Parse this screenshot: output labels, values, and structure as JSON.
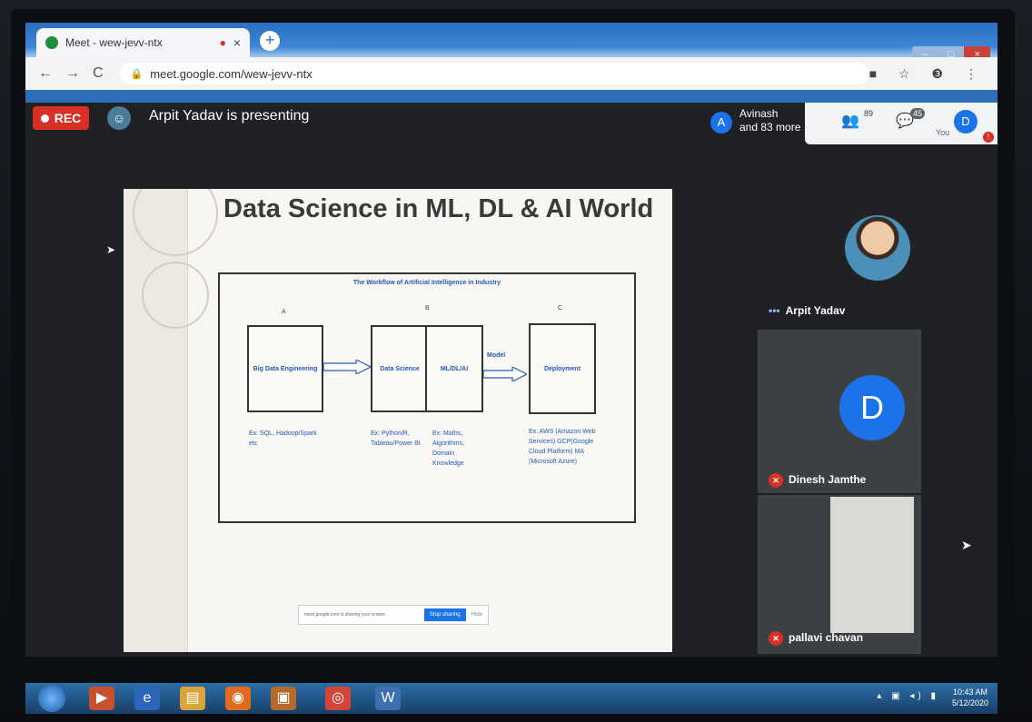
{
  "browser": {
    "tab_title": "Meet - wew-jevv-ntx",
    "tab_close": "×",
    "new_tab": "+",
    "url": "meet.google.com/wew-jevv-ntx",
    "nav": {
      "back": "←",
      "forward": "→",
      "reload": "C"
    },
    "toolbar_right": "■ ☆ ❸ ⋮",
    "win_controls": {
      "min": "–",
      "max": "□",
      "close": "×"
    }
  },
  "meet": {
    "rec_label": "REC",
    "presenting_text": "Arpit Yadav is presenting",
    "people_initial": "A",
    "people_line1": "Avinash",
    "people_line2": "and 83 more",
    "participants_count": "89",
    "chat_count": "45",
    "you_initial": "D",
    "you_label": "You"
  },
  "slide": {
    "title": "Data Science in ML, DL & AI World",
    "workflow_title": "The Workflow of Artificial Intelligence in Industry",
    "labels": {
      "a": "A",
      "b": "B",
      "c": "C",
      "model": "Model"
    },
    "boxes": {
      "big_data": "Big Data Engineering",
      "data_science": "Data Science",
      "ml_dl_ai": "ML/DL/AI",
      "deployment": "Deployment"
    },
    "examples": {
      "a": "Ex: SQL, Hadoop/Spark etc",
      "b1": "Ex: Python/R, Tableau/Power BI",
      "b2": "Ex: Maths, Algorithms, Domain Knowledge",
      "c": "Ex: AWS (Amazon Web Services) GCP(Google Cloud Platform) MA (Microsoft Azure)"
    },
    "share_msg": "meet.google.com is sharing your screen.",
    "stop_sharing": "Stop sharing",
    "hide": "Hide"
  },
  "participants": [
    {
      "name": "Arpit Yadav"
    },
    {
      "name": "Dinesh Jamthe",
      "initial": "D"
    },
    {
      "name": "pallavi chavan"
    }
  ],
  "taskbar": {
    "time": "10:43 AM",
    "date": "5/12/2020"
  },
  "colors": {
    "rec": "#d93025",
    "meet_bg": "#202124",
    "accent": "#1a73e8"
  }
}
